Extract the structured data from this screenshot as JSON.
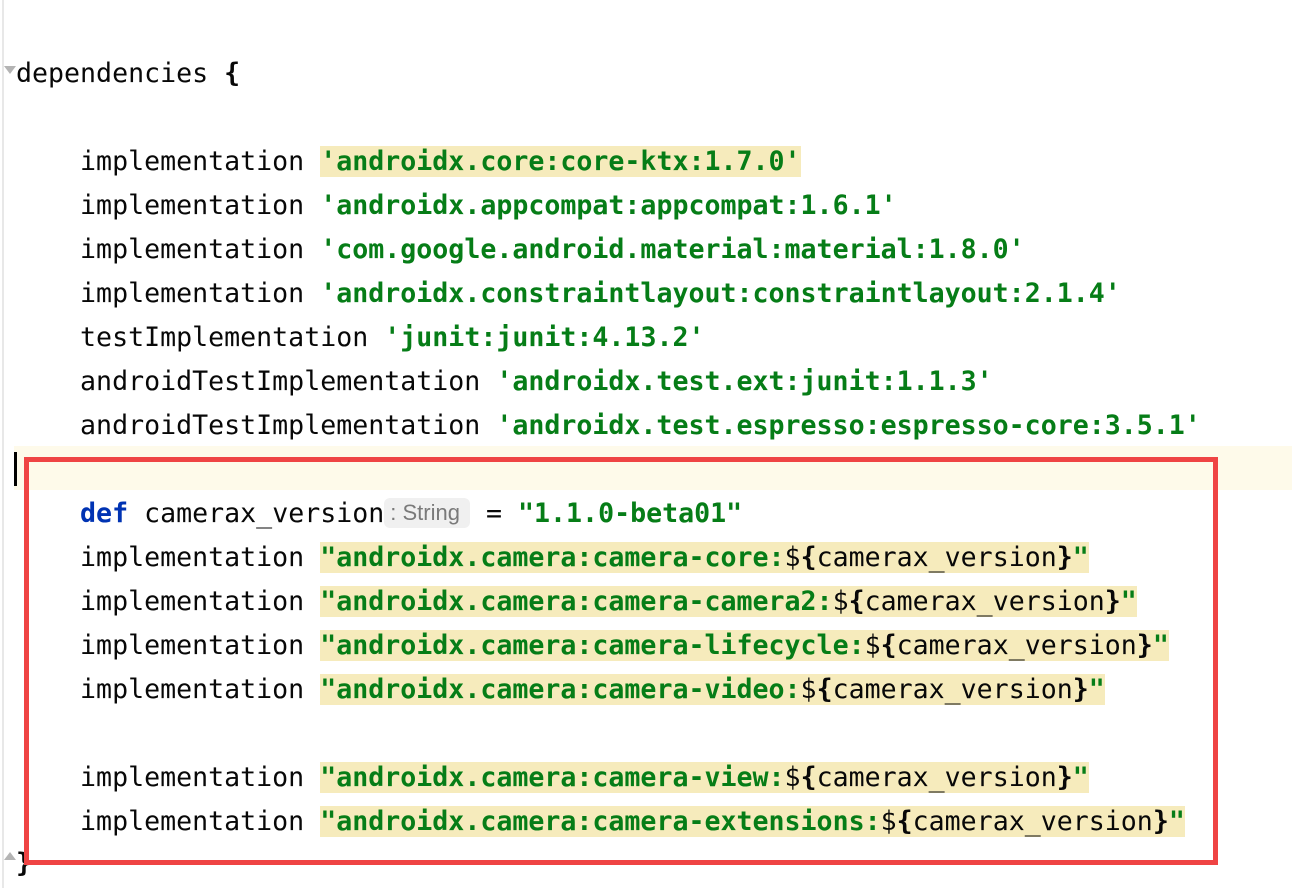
{
  "code": {
    "open_line": {
      "ident": "dependencies ",
      "brace": "{"
    },
    "close_brace": "}",
    "dependency_lines": [
      {
        "config": "implementation ",
        "value": "'androidx.core:core-ktx:1.7.0'"
      },
      {
        "config": "implementation ",
        "value": "'androidx.appcompat:appcompat:1.6.1'"
      },
      {
        "config": "implementation ",
        "value": "'com.google.android.material:material:1.8.0'"
      },
      {
        "config": "implementation ",
        "value": "'androidx.constraintlayout:constraintlayout:2.1.4'"
      },
      {
        "config": "testImplementation ",
        "value": "'junit:junit:4.13.2'"
      },
      {
        "config": "androidTestImplementation ",
        "value": "'androidx.test.ext:junit:1.1.3'"
      },
      {
        "config": "androidTestImplementation ",
        "value": "'androidx.test.espresso:espresso-core:3.5.1'"
      }
    ],
    "def_line": {
      "keyword": "def",
      "name": " camerax_version",
      "type_hint": ": String",
      "assign": "= ",
      "value": "\"1.1.0-beta01\""
    },
    "camera_lines": [
      {
        "config": "implementation ",
        "prefix": "\"androidx.camera:camera-core:",
        "dollar": "$",
        "open": "{",
        "var": "camerax_version",
        "close": "}",
        "quote": "\""
      },
      {
        "config": "implementation ",
        "prefix": "\"androidx.camera:camera-camera2:",
        "dollar": "$",
        "open": "{",
        "var": "camerax_version",
        "close": "}",
        "quote": "\""
      },
      {
        "config": "implementation ",
        "prefix": "\"androidx.camera:camera-lifecycle:",
        "dollar": "$",
        "open": "{",
        "var": "camerax_version",
        "close": "}",
        "quote": "\""
      },
      {
        "config": "implementation ",
        "prefix": "\"androidx.camera:camera-video:",
        "dollar": "$",
        "open": "{",
        "var": "camerax_version",
        "close": "}",
        "quote": "\""
      },
      {
        "config": "implementation ",
        "prefix": "\"androidx.camera:camera-view:",
        "dollar": "$",
        "open": "{",
        "var": "camerax_version",
        "close": "}",
        "quote": "\""
      },
      {
        "config": "implementation ",
        "prefix": "\"androidx.camera:camera-extensions:",
        "dollar": "$",
        "open": "{",
        "var": "camerax_version",
        "close": "}",
        "quote": "\""
      }
    ]
  },
  "colors": {
    "keyword": "#0033b3",
    "string": "#067d17",
    "string_highlight": "#f6ebbc",
    "current_line": "#fefaea",
    "annotation_box": "#ef4444"
  }
}
